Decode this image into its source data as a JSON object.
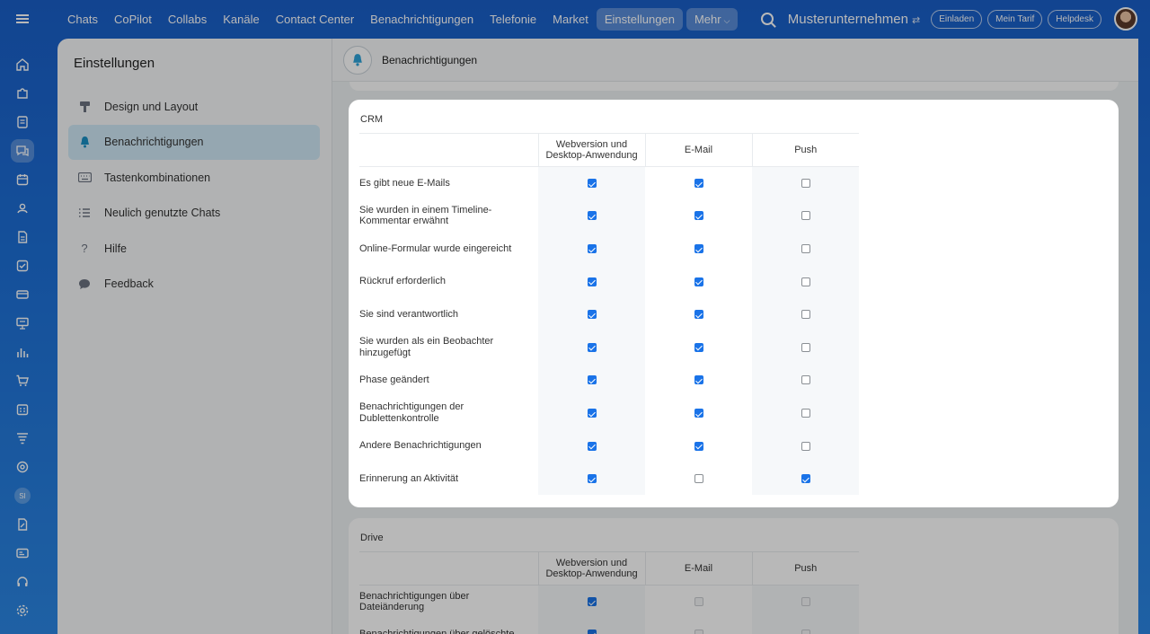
{
  "topbar": {
    "nav": [
      "Chats",
      "CoPilot",
      "Collabs",
      "Kanäle",
      "Contact Center",
      "Benachrichtigungen",
      "Telefonie",
      "Market",
      "Einstellungen"
    ],
    "more_label": "Mehr",
    "company": "Musterunternehmen",
    "invite_label": "Einladen",
    "tariff_label": "Mein Tarif",
    "helpdesk_label": "Helpdesk"
  },
  "rail": {
    "icons": [
      "home-icon",
      "puzzle-icon",
      "feed-icon",
      "chat-icon",
      "calendar-icon",
      "contacts-icon",
      "document-icon",
      "tasks-icon",
      "card-icon",
      "presentation-icon",
      "chart-icon",
      "cart-icon",
      "schedule-icon",
      "funnel-icon",
      "target-icon",
      "si-avatar",
      "sign-icon",
      "id-icon",
      "support-icon",
      "settings-icon"
    ],
    "si_label": "SI"
  },
  "settings": {
    "title": "Einstellungen",
    "menu": [
      {
        "label": "Design und Layout",
        "icon": "paint-roller-icon"
      },
      {
        "label": "Benachrichtigungen",
        "icon": "bell-icon"
      },
      {
        "label": "Tastenkombinationen",
        "icon": "keyboard-icon"
      },
      {
        "label": "Neulich genutzte Chats",
        "icon": "list-icon"
      },
      {
        "label": "Hilfe",
        "icon": "question-icon"
      },
      {
        "label": "Feedback",
        "icon": "speech-bubble-icon"
      }
    ]
  },
  "header": {
    "title": "Benachrichtigungen"
  },
  "columns": {
    "web": "Webversion und Desktop-Anwendung",
    "email": "E-Mail",
    "push": "Push"
  },
  "crm": {
    "title": "CRM",
    "rows": [
      {
        "label": "Es gibt neue E-Mails",
        "web": true,
        "email": true,
        "push": false
      },
      {
        "label": "Sie wurden in einem Timeline-Kommentar erwähnt",
        "web": true,
        "email": true,
        "push": false
      },
      {
        "label": "Online-Formular wurde eingereicht",
        "web": true,
        "email": true,
        "push": false
      },
      {
        "label": "Rückruf erforderlich",
        "web": true,
        "email": true,
        "push": false
      },
      {
        "label": "Sie sind verantwortlich",
        "web": true,
        "email": true,
        "push": false
      },
      {
        "label": "Sie wurden als ein Beobachter hinzugefügt",
        "web": true,
        "email": true,
        "push": false
      },
      {
        "label": "Phase geändert",
        "web": true,
        "email": true,
        "push": false
      },
      {
        "label": "Benachrichtigungen der Dublettenkontrolle",
        "web": true,
        "email": true,
        "push": false
      },
      {
        "label": "Andere Benachrichtigungen",
        "web": true,
        "email": true,
        "push": false
      },
      {
        "label": "Erinnerung an Aktivität",
        "web": true,
        "email": false,
        "push": true
      }
    ]
  },
  "drive": {
    "title": "Drive",
    "rows": [
      {
        "label": "Benachrichtigungen über Dateiänderung",
        "web": true,
        "email": false,
        "push": false
      },
      {
        "label": "Benachrichtigungen über gelöschte",
        "web": true,
        "email": false,
        "push": false
      }
    ]
  }
}
